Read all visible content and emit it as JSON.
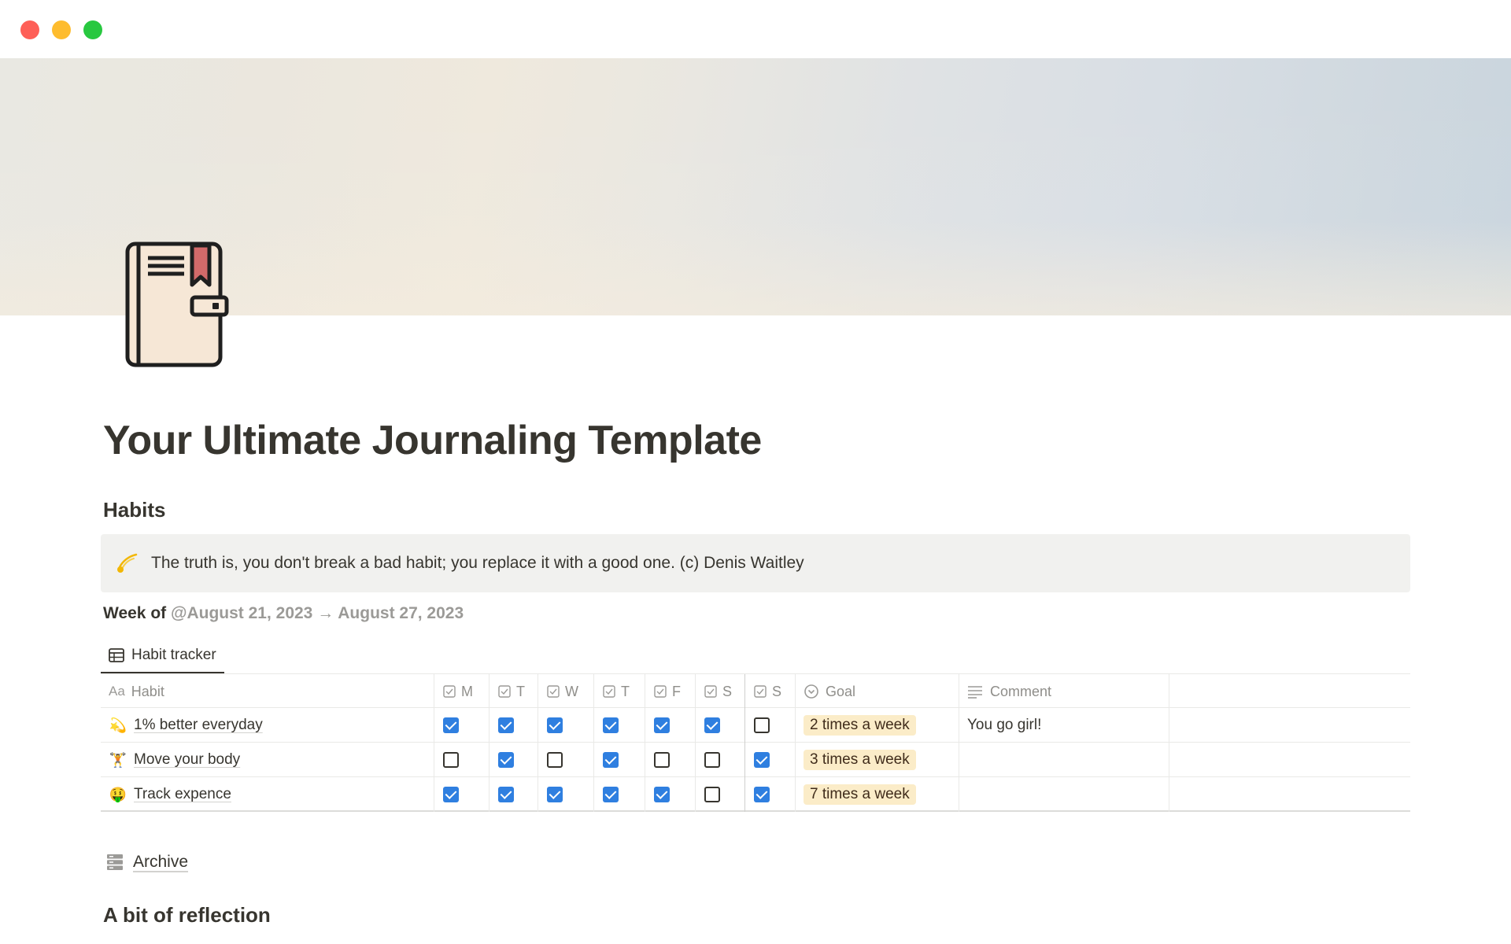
{
  "window": {
    "controls": [
      "close",
      "minimize",
      "maximize"
    ]
  },
  "page": {
    "icon": "journal-book-icon",
    "title": "Your Ultimate Journaling Template"
  },
  "habits": {
    "heading": "Habits",
    "callout": {
      "icon": "comet-icon",
      "text": "The truth is, you don't break a bad habit; you replace it with a good one. (c) Denis Waitley"
    },
    "week": {
      "label": "Week of",
      "range": "@August 21, 2023 → August 27, 2023"
    },
    "view_tab": {
      "icon": "table-icon",
      "label": "Habit tracker"
    },
    "table": {
      "columns": {
        "habit": "Habit",
        "habit_prefix": "Aa",
        "days": [
          "M",
          "T",
          "W",
          "T",
          "F",
          "S",
          "S"
        ],
        "goal": "Goal",
        "comment": "Comment"
      },
      "rows": [
        {
          "icon": "comet-icon",
          "emoji": "💫",
          "name": "1% better everyday",
          "days": [
            true,
            true,
            true,
            true,
            true,
            true,
            false
          ],
          "goal": "2 times a week",
          "comment": "You go girl!"
        },
        {
          "icon": "person-lifting-weights-icon",
          "emoji": "🏋️",
          "name": "Move your body",
          "days": [
            false,
            true,
            false,
            true,
            false,
            false,
            true
          ],
          "goal": "3 times a week",
          "comment": ""
        },
        {
          "icon": "money-mouth-face-icon",
          "emoji": "🤑",
          "name": "Track expence",
          "days": [
            true,
            true,
            true,
            true,
            true,
            false,
            true
          ],
          "goal": "7 times a week",
          "comment": ""
        }
      ]
    },
    "archive": {
      "icon": "archive-icon",
      "label": "Archive"
    }
  },
  "reflection": {
    "heading": "A bit of reflection"
  },
  "colors": {
    "checkbox_checked": "#2f7fe0",
    "goal_tag_bg": "#fbecc8",
    "callout_bg": "#f1f1ef",
    "text": "#37352f"
  }
}
